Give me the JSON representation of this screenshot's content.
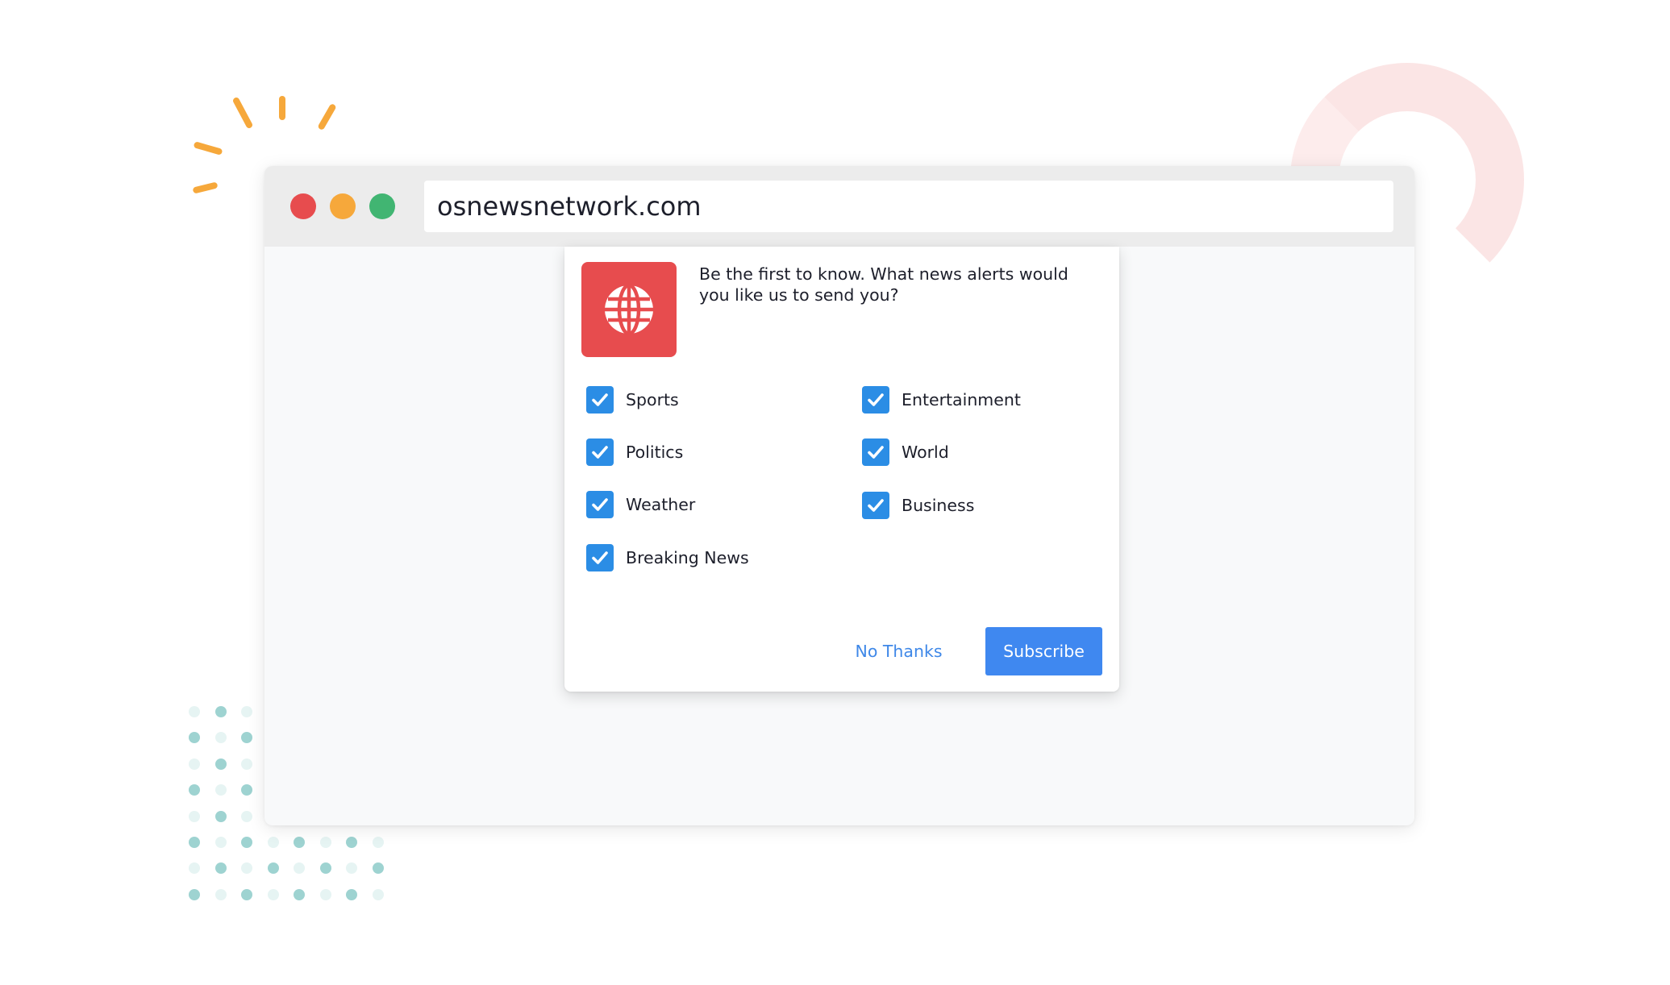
{
  "browser": {
    "url": "osnewsnetwork.com",
    "controls": {
      "close_color": "#e74c4e",
      "minimize_color": "#f6a83b",
      "maximize_color": "#41b572"
    }
  },
  "dialog": {
    "logo_icon": "globe-icon",
    "prompt": "Be the first to know. What news alerts would you like us to send you?",
    "options": [
      {
        "label": "Sports",
        "checked": true
      },
      {
        "label": "Politics",
        "checked": true
      },
      {
        "label": "Weather",
        "checked": true
      },
      {
        "label": "Breaking News",
        "checked": true
      },
      {
        "label": "Entertainment",
        "checked": true
      },
      {
        "label": "World",
        "checked": true
      },
      {
        "label": "Business",
        "checked": true
      }
    ],
    "no_thanks_label": "No Thanks",
    "subscribe_label": "Subscribe"
  },
  "colors": {
    "brand_red": "#e74c4e",
    "checkbox_blue": "#2b8de5",
    "button_blue": "#3f88f0",
    "link_blue": "#3f88e8"
  }
}
